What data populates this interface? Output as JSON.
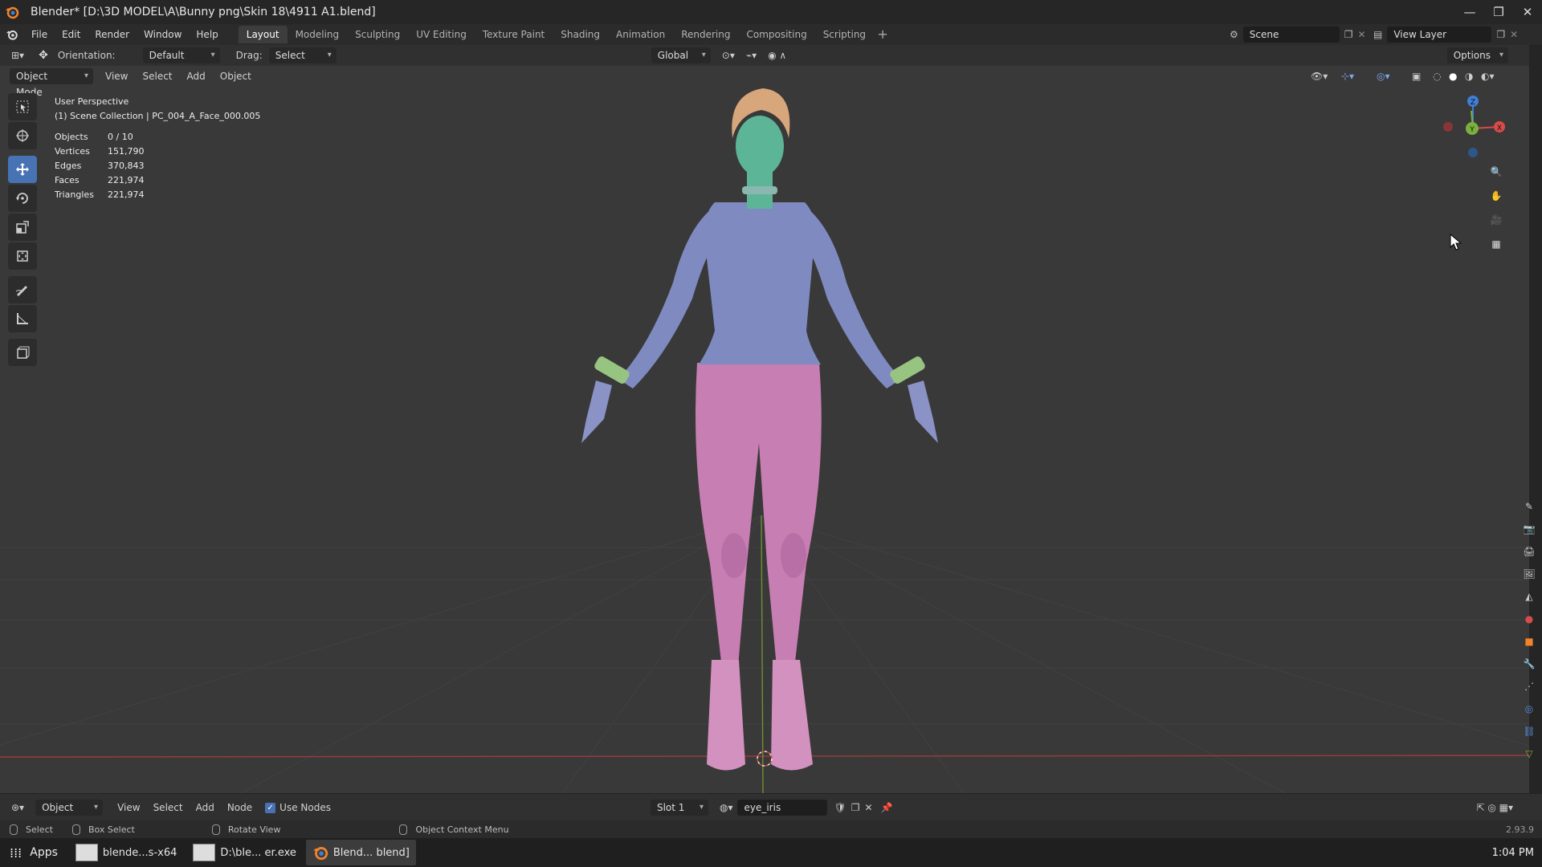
{
  "window": {
    "title": "Blender* [D:\\3D MODEL\\A\\Bunny png\\Skin 18\\4911 A1.blend]",
    "controls": [
      "—",
      "❐",
      "✕"
    ]
  },
  "menus": [
    "File",
    "Edit",
    "Render",
    "Window",
    "Help"
  ],
  "workspaces": {
    "tabs": [
      "Layout",
      "Modeling",
      "Sculpting",
      "UV Editing",
      "Texture Paint",
      "Shading",
      "Animation",
      "Rendering",
      "Compositing",
      "Scripting"
    ],
    "active": "Layout",
    "add": "+"
  },
  "scene": {
    "name": "Scene"
  },
  "view_layer": {
    "name": "View Layer"
  },
  "tool_settings": {
    "orientation_label": "Orientation:",
    "orientation_value": "Default",
    "drag_label": "Drag:",
    "drag_value": "Select Box",
    "transform_orientation": "Global",
    "options": "Options"
  },
  "viewport_header": {
    "mode": "Object Mode",
    "menus": [
      "View",
      "Select",
      "Add",
      "Object"
    ]
  },
  "viewport": {
    "perspective": "User Perspective",
    "collection": "(1) Scene Collection | PC_004_A_Face_000.005",
    "stats": [
      {
        "key": "Objects",
        "value": "0 / 10"
      },
      {
        "key": "Vertices",
        "value": "151,790"
      },
      {
        "key": "Edges",
        "value": "370,843"
      },
      {
        "key": "Faces",
        "value": "221,974"
      },
      {
        "key": "Triangles",
        "value": "221,974"
      }
    ]
  },
  "shader_header": {
    "editor": "Object",
    "menus": [
      "View",
      "Select",
      "Add",
      "Node"
    ],
    "use_nodes_label": "Use Nodes",
    "use_nodes_checked": true,
    "slot": "Slot 1",
    "material": "eye_iris"
  },
  "statusbar": {
    "select": "Select",
    "box_select": "Box Select",
    "rotate_view": "Rotate View",
    "context_menu": "Object Context Menu",
    "version": "2.93.9"
  },
  "taskbar": {
    "apps": "Apps",
    "windows": [
      {
        "label": "blende...s-x64",
        "active": false
      },
      {
        "label": "D:\\ble... er.exe",
        "active": false
      },
      {
        "label": "Blend... blend]",
        "active": true
      }
    ],
    "clock": "1:04 PM"
  },
  "colors": {
    "accent": "#4772b3",
    "axis_x": "#d84b4b",
    "axis_y": "#7ab13c",
    "axis_z": "#3f7fd6",
    "skin": "#5cb597",
    "top": "#7f8bc0",
    "pants": "#c77eb2",
    "bands": "#98c481",
    "hair": "#d8a67b"
  }
}
